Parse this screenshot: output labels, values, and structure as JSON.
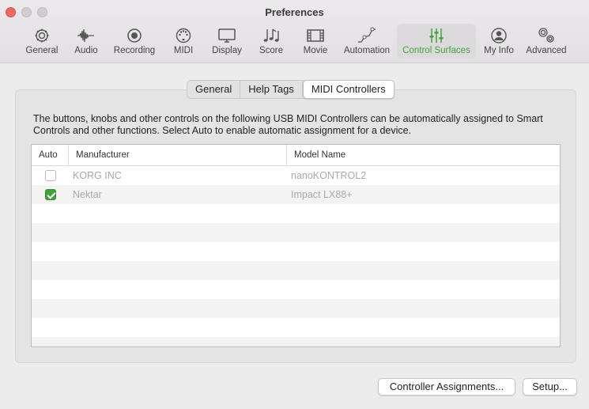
{
  "window": {
    "title": "Preferences"
  },
  "toolbar": {
    "items": [
      {
        "label": "General",
        "icon": "gear-icon"
      },
      {
        "label": "Audio",
        "icon": "waveform-icon"
      },
      {
        "label": "Recording",
        "icon": "record-icon"
      },
      {
        "label": "MIDI",
        "icon": "midi-port-icon"
      },
      {
        "label": "Display",
        "icon": "monitor-icon"
      },
      {
        "label": "Score",
        "icon": "music-notes-icon"
      },
      {
        "label": "Movie",
        "icon": "film-icon"
      },
      {
        "label": "Automation",
        "icon": "automation-curve-icon"
      },
      {
        "label": "Control Surfaces",
        "icon": "sliders-icon",
        "active": true
      },
      {
        "label": "My Info",
        "icon": "user-icon"
      },
      {
        "label": "Advanced",
        "icon": "gears-icon"
      }
    ],
    "accent": "#3fa53a"
  },
  "tabs": [
    {
      "label": "General"
    },
    {
      "label": "Help Tags"
    },
    {
      "label": "MIDI Controllers",
      "selected": true
    }
  ],
  "description": "The buttons, knobs and other controls on the following USB MIDI Controllers can be automatically assigned to Smart Controls and other functions. Select Auto to enable automatic assignment for a device.",
  "table": {
    "columns": {
      "auto": "Auto",
      "manufacturer": "Manufacturer",
      "model": "Model Name"
    },
    "rows": [
      {
        "auto": false,
        "manufacturer": "KORG INC",
        "model": "nanoKONTROL2"
      },
      {
        "auto": true,
        "manufacturer": "Nektar",
        "model": "Impact LX88+"
      }
    ]
  },
  "buttons": {
    "assignments": "Controller Assignments...",
    "setup": "Setup..."
  }
}
